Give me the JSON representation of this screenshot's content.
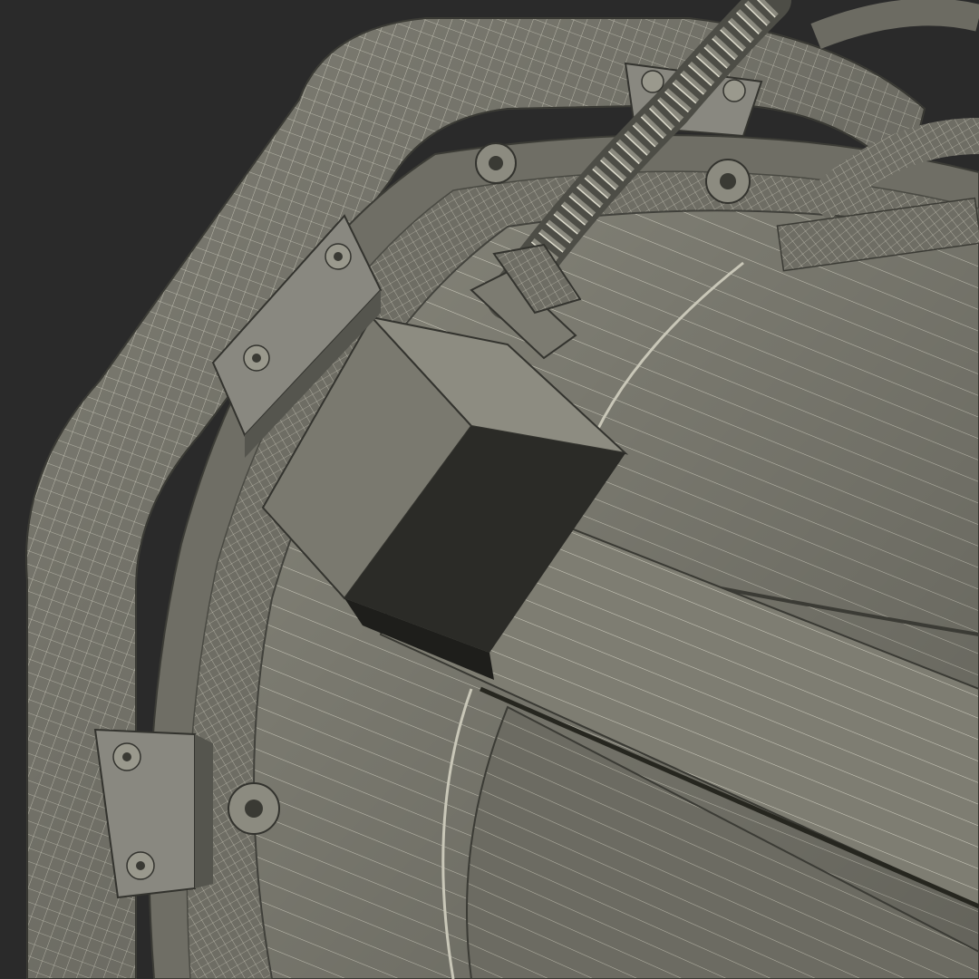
{
  "scene": {
    "subject": "wireframe-3d-render",
    "palette": {
      "background": "#2a2a2a",
      "surface_light": "#8e8d82",
      "surface_mid": "#77766c",
      "surface_dark": "#5a5a52",
      "shadow": "#1f1f1c",
      "wire": "#e6e4d6"
    },
    "fastener_count": 9
  }
}
